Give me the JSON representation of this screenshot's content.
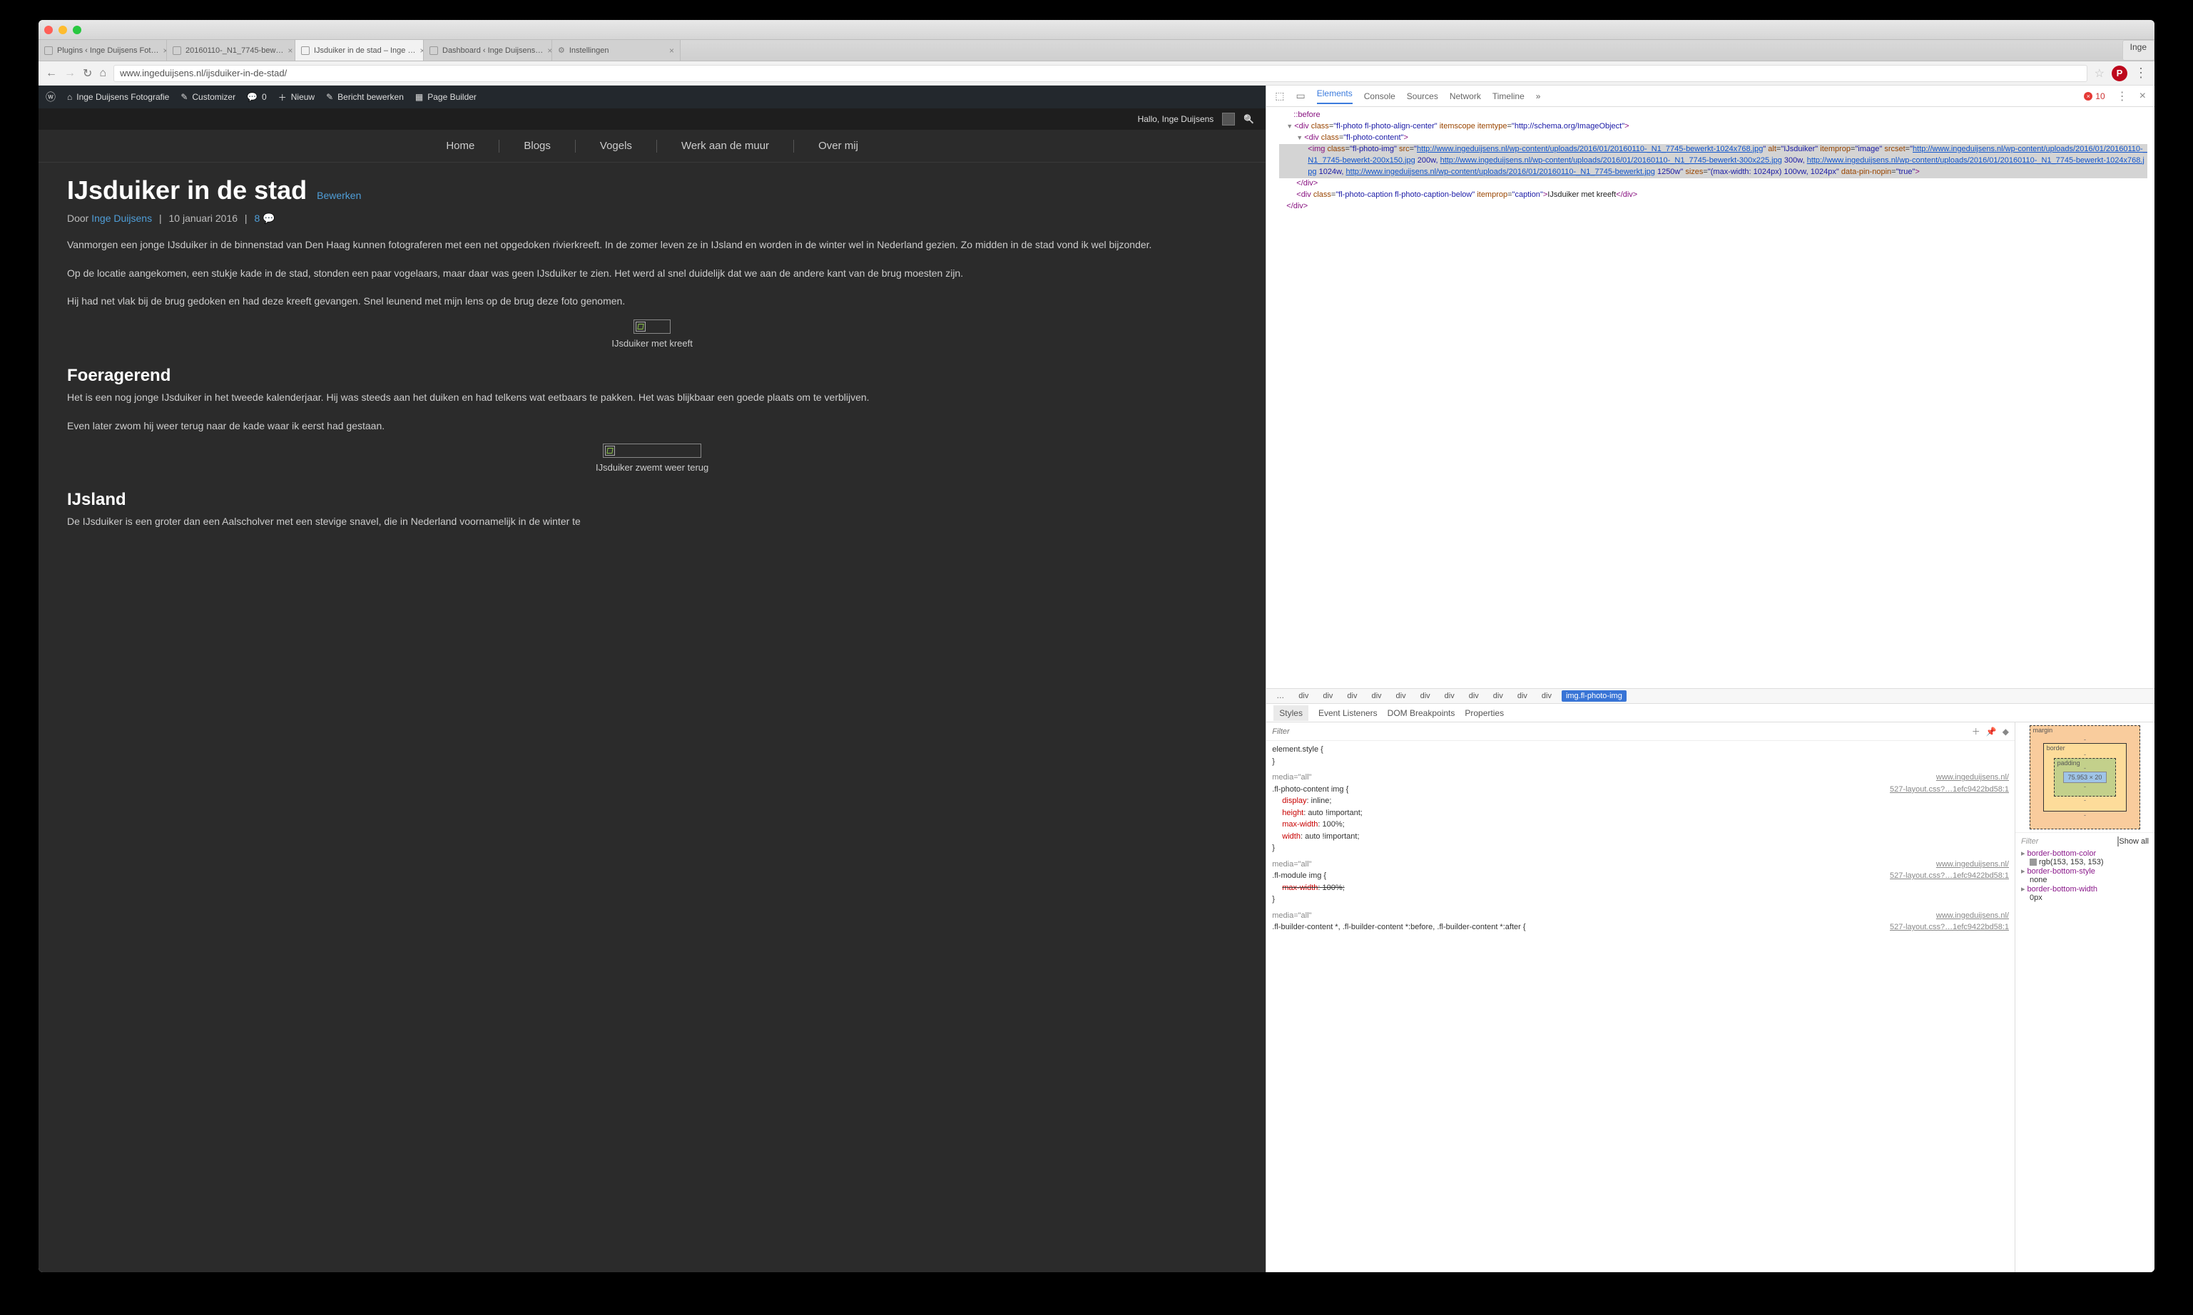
{
  "browser": {
    "user_chip": "Inge",
    "tabs": [
      {
        "label": "Plugins ‹ Inge Duijsens Fot…",
        "active": false,
        "icon": "file"
      },
      {
        "label": "20160110-_N1_7745-bew…",
        "active": false,
        "icon": "file"
      },
      {
        "label": "IJsduiker in de stad – Inge …",
        "active": true,
        "icon": "file"
      },
      {
        "label": "Dashboard ‹ Inge Duijsens…",
        "active": false,
        "icon": "file"
      },
      {
        "label": "Instellingen",
        "active": false,
        "icon": "gear"
      }
    ],
    "url": "www.ingeduijsens.nl/ijsduiker-in-de-stad/"
  },
  "wpbar": {
    "site": "Inge Duijsens Fotografie",
    "customizer": "Customizer",
    "comments": "0",
    "new": "Nieuw",
    "edit": "Bericht bewerken",
    "pagebuilder": "Page Builder"
  },
  "greeting": "Hallo, Inge Duijsens",
  "nav": [
    "Home",
    "Blogs",
    "Vogels",
    "Werk aan de muur",
    "Over mij"
  ],
  "article": {
    "title": "IJsduiker in de stad",
    "edit": "Bewerken",
    "by": "Door",
    "author": "Inge Duijsens",
    "date": "10 januari 2016",
    "comments": "8",
    "p1": "Vanmorgen een jonge IJsduiker in de binnenstad van Den Haag kunnen fotograferen met  een net opgedoken rivierkreeft. In de zomer leven ze in IJsland en worden in de winter wel in Nederland gezien. Zo midden in de stad vond ik wel bijzonder.",
    "p2": "Op de locatie aangekomen, een stukje kade in de stad,  stonden een paar vogelaars, maar daar was geen IJsduiker te zien. Het werd al snel duidelijk dat we aan de andere kant van de brug moesten zijn.",
    "p3": "Hij had net vlak bij de brug gedoken en had deze kreeft gevangen. Snel leunend met mijn lens op de brug deze foto genomen.",
    "cap1": "IJsduiker met kreeft",
    "h2a": "Foeragerend",
    "p4": "Het is een nog jonge IJsduiker in het tweede kalenderjaar. Hij was steeds aan het duiken en had telkens wat eetbaars te pakken. Het was blijkbaar een goede plaats om te verblijven.",
    "p5": "Even later zwom hij weer terug naar de kade waar ik eerst had gestaan.",
    "cap2": "IJsduiker zwemt weer terug",
    "h2b": "IJsland",
    "p6": "De IJsduiker is een groter dan een Aalscholver met een stevige snavel, die in Nederland voornamelijk in de winter te"
  },
  "devtools": {
    "tabs": [
      "Elements",
      "Console",
      "Sources",
      "Network",
      "Timeline"
    ],
    "chevron": "»",
    "error_count": "10",
    "subtabs": [
      "Styles",
      "Event Listeners",
      "DOM Breakpoints",
      "Properties"
    ],
    "filter_placeholder": "Filter",
    "dom": {
      "before": "::before",
      "div1_class": "fl-photo fl-photo-align-center",
      "itemscope": "itemscope",
      "itemtype": "http://schema.org/ImageObject",
      "div2_class": "fl-photo-content",
      "img_class": "fl-photo-img",
      "src": "http://www.ingeduijsens.nl/wp-content/uploads/2016/01/20160110-_N1_7745-bewerkt-1024x768.jpg",
      "alt": "IJsduiker",
      "itemprop": "image",
      "srcset1": "http://www.ingeduijsens.nl/wp-content/uploads/2016/01/20160110-_N1_7745-bewerkt-200x150.jpg",
      "srcset1_w": "200w,",
      "srcset2": "http://www.ingeduijsens.nl/wp-content/uploads/2016/01/20160110-_N1_7745-bewerkt-300x225.jpg",
      "srcset2_w": "300w,",
      "srcset3": "http://www.ingeduijsens.nl/wp-content/uploads/2016/01/20160110-_N1_7745-bewerkt-1024x768.jpg",
      "srcset3_w": "1024w,",
      "srcset4": "http://www.ingeduijsens.nl/wp-content/uploads/2016/01/20160110-_N1_7745-bewerkt.jpg",
      "srcset4_w": "1250w",
      "sizes": "(max-width: 1024px) 100vw, 1024px",
      "pin": "true",
      "caption_class": "fl-photo-caption fl-photo-caption-below",
      "caption_itemprop": "caption",
      "caption_text": "IJsduiker met kreeft"
    },
    "crumbs": [
      "…",
      "div",
      "div",
      "div",
      "div",
      "div",
      "div",
      "div",
      "div",
      "div",
      "div",
      "div",
      "img.fl-photo-img"
    ],
    "styles": {
      "el": "element.style {",
      "r1_media": "media=\"all\"",
      "r1_src": "www.ingeduijsens.nl/",
      "r1_sel": ".fl-photo-content img {",
      "r1_file": "527-layout.css?…1efc9422bd58:1",
      "r1_p": [
        {
          "n": "display",
          "v": "inline;"
        },
        {
          "n": "height",
          "v": "auto !important;"
        },
        {
          "n": "max-width",
          "v": "100%;"
        },
        {
          "n": "width",
          "v": "auto !important;"
        }
      ],
      "r2_sel": ".fl-module img {",
      "r2_p": {
        "n": "max-width",
        "v": "100%;"
      },
      "r3_sel": ".fl-builder-content *, .fl-builder-content *:before, .fl-builder-content *:after {"
    },
    "box": {
      "margin": "margin",
      "border": "border",
      "padding": "padding",
      "content": "75.953 × 20",
      "dash": "-"
    },
    "computed": {
      "show_all": "Show all",
      "props": [
        {
          "n": "border-bottom-color",
          "v": "rgb(153, 153, 153)",
          "swatch": true
        },
        {
          "n": "border-bottom-style",
          "v": "none"
        },
        {
          "n": "border-bottom-width",
          "v": "0px"
        }
      ]
    }
  }
}
